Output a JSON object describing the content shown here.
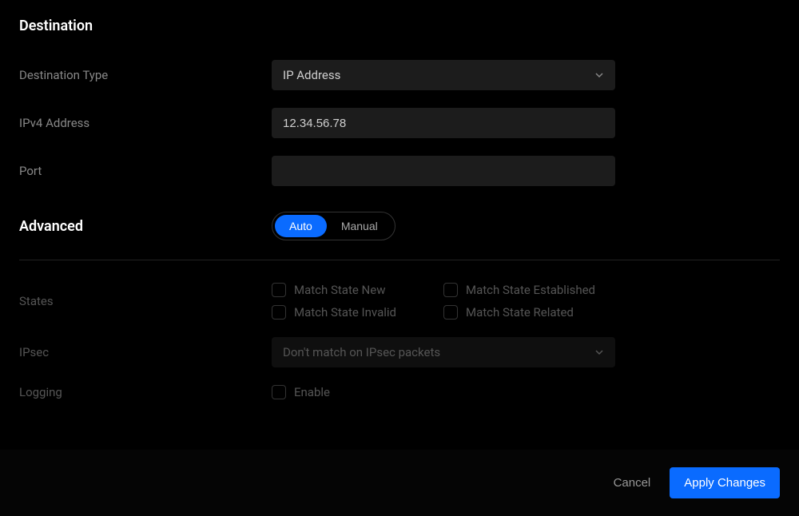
{
  "destination": {
    "heading": "Destination",
    "type_label": "Destination Type",
    "type_value": "IP Address",
    "ipv4_label": "IPv4 Address",
    "ipv4_value": "12.34.56.78",
    "port_label": "Port",
    "port_value": ""
  },
  "advanced": {
    "heading": "Advanced",
    "mode_auto": "Auto",
    "mode_manual": "Manual",
    "states_label": "States",
    "state_new": "Match State New",
    "state_established": "Match State Established",
    "state_invalid": "Match State Invalid",
    "state_related": "Match State Related",
    "ipsec_label": "IPsec",
    "ipsec_value": "Don't match on IPsec packets",
    "logging_label": "Logging",
    "logging_enable": "Enable"
  },
  "footer": {
    "cancel": "Cancel",
    "apply": "Apply Changes"
  }
}
